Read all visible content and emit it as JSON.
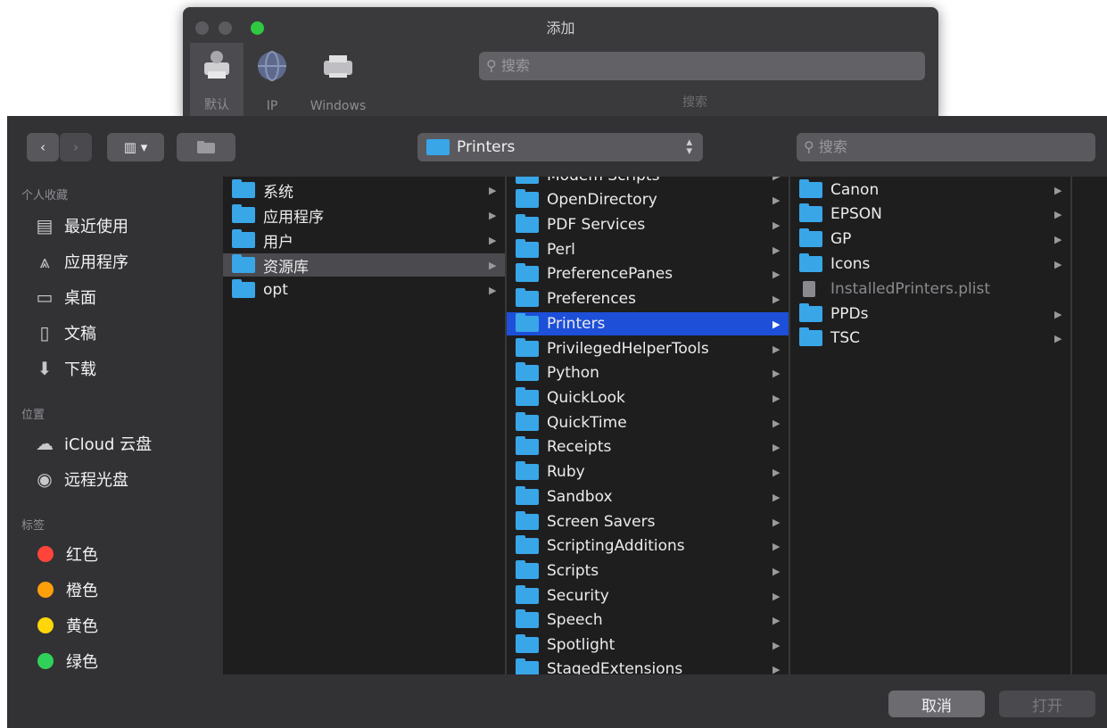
{
  "add_window": {
    "title": "添加",
    "toolbar": [
      {
        "label": "默认",
        "icon": "default-printer-icon",
        "active": true
      },
      {
        "label": "IP",
        "icon": "globe-icon",
        "active": false
      },
      {
        "label": "Windows",
        "icon": "windows-printer-icon",
        "active": false
      }
    ],
    "search_placeholder": "搜索",
    "search_label": "搜索"
  },
  "dialog": {
    "toolbar": {
      "back": "‹",
      "forward": "›",
      "view_icon": "column-view-icon",
      "view_label": "▥ ▾",
      "folder_icon": "folder-group-icon",
      "path": "Printers",
      "search_placeholder": "搜索"
    },
    "sidebar": {
      "favorites_header": "个人收藏",
      "favorites": [
        {
          "label": "最近使用",
          "icon": "recents-icon"
        },
        {
          "label": "应用程序",
          "icon": "applications-icon"
        },
        {
          "label": "桌面",
          "icon": "desktop-icon"
        },
        {
          "label": "文稿",
          "icon": "documents-icon"
        },
        {
          "label": "下载",
          "icon": "downloads-icon"
        }
      ],
      "locations_header": "位置",
      "locations": [
        {
          "label": "iCloud 云盘",
          "icon": "icloud-icon"
        },
        {
          "label": "远程光盘",
          "icon": "remote-disc-icon"
        }
      ],
      "tags_header": "标签",
      "tags": [
        {
          "label": "红色",
          "color": "#ff453a"
        },
        {
          "label": "橙色",
          "color": "#ff9f0a"
        },
        {
          "label": "黄色",
          "color": "#ffd60a"
        },
        {
          "label": "绿色",
          "color": "#30d158"
        }
      ]
    },
    "columns": {
      "col1": [
        "系统",
        "应用程序",
        "用户",
        "资源库",
        "opt"
      ],
      "col1_selected": "资源库",
      "col2": [
        "Modem Scripts",
        "OpenDirectory",
        "PDF Services",
        "Perl",
        "PreferencePanes",
        "Preferences",
        "Printers",
        "PrivilegedHelperTools",
        "Python",
        "QuickLook",
        "QuickTime",
        "Receipts",
        "Ruby",
        "Sandbox",
        "Screen Savers",
        "ScriptingAdditions",
        "Scripts",
        "Security",
        "Speech",
        "Spotlight",
        "StagedExtensions"
      ],
      "col2_selected": "Printers",
      "col3": [
        {
          "name": "Canon",
          "kind": "folder"
        },
        {
          "name": "EPSON",
          "kind": "folder"
        },
        {
          "name": "GP",
          "kind": "folder"
        },
        {
          "name": "Icons",
          "kind": "folder"
        },
        {
          "name": "InstalledPrinters.plist",
          "kind": "file"
        },
        {
          "name": "PPDs",
          "kind": "folder"
        },
        {
          "name": "TSC",
          "kind": "folder"
        }
      ]
    },
    "buttons": {
      "cancel": "取消",
      "open": "打开"
    }
  }
}
